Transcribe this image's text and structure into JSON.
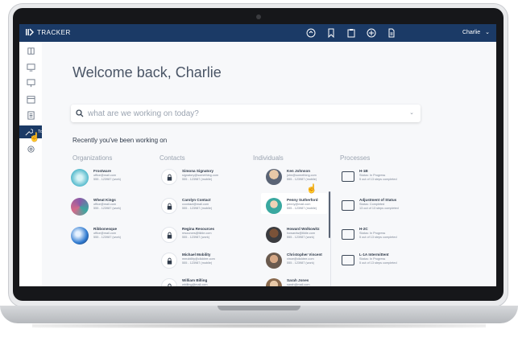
{
  "app": {
    "brand": "TRACKER",
    "user_name": "Charlie",
    "user_chevron": "⌄"
  },
  "topbar": {
    "icons": [
      "chat-icon",
      "bookmark-icon",
      "clipboard-icon",
      "add-circle-icon",
      "document-icon"
    ]
  },
  "sidebar": {
    "items": [
      {
        "icon": "book-icon",
        "label": ""
      },
      {
        "icon": "monitor-icon",
        "label": ""
      },
      {
        "icon": "presentation-icon",
        "label": ""
      },
      {
        "icon": "calendar-icon",
        "label": ""
      },
      {
        "icon": "list-icon",
        "label": ""
      },
      {
        "icon": "wrench-icon",
        "label": "Tools"
      },
      {
        "icon": "settings-icon",
        "label": ""
      }
    ]
  },
  "main": {
    "welcome": "Welcome back, Charlie",
    "search_placeholder": "what are we working on today?",
    "recent_title": "Recently you've been working on",
    "columns": {
      "organizations": "Organizations",
      "contacts": "Contacts",
      "individuals": "Individuals",
      "processes": "Processes"
    },
    "organizations": [
      {
        "name": "Frostware",
        "email": "office@mail.com",
        "phone": "555 - 123987 (work)"
      },
      {
        "name": "Wheat Kings",
        "email": "office@mail.com",
        "phone": "555 - 123987 (work)"
      },
      {
        "name": "Ribbonesque",
        "email": "office@mail.com",
        "phone": "555 - 123987 (work)"
      }
    ],
    "contacts": [
      {
        "name": "Simona Signatory",
        "email": "signatory@something.com",
        "phone": "555 - 123987 (mobile)"
      },
      {
        "name": "Carolyn Contact",
        "email": "ccontact@mail.com",
        "phone": "555 - 123987 (mobile)"
      },
      {
        "name": "Regina Resources",
        "email": "resources@tiktie.com",
        "phone": "555 - 123987 (work)"
      },
      {
        "name": "Michael Mobility",
        "email": "mmobility@clicktee.com",
        "phone": "555 - 123987 (mobile)"
      },
      {
        "name": "William Billing",
        "email": "wbilling@mail.com",
        "phone": ""
      }
    ],
    "individuals": [
      {
        "name": "Ken Johnson",
        "email": "john@something.com",
        "phone": "555 - 123987 (mobile)"
      },
      {
        "name": "Penny Sutherford",
        "email": "penny@mail.com",
        "phone": "555 - 123987 (mobile)"
      },
      {
        "name": "Howard Wolkowitz",
        "email": "howardw@tiktie.com",
        "phone": "555 - 123987 (work)"
      },
      {
        "name": "Christopher Vincent",
        "email": "vince@clicktee.com",
        "phone": "555 - 123987 (work)"
      },
      {
        "name": "Sarah Jones",
        "email": "sarah@mail.com",
        "phone": ""
      }
    ],
    "processes": [
      {
        "name": "H-1B",
        "status": "Status: In Progress",
        "steps": "5 out of 13 steps completed"
      },
      {
        "name": "Adjustment of Status",
        "status": "Status: Completed",
        "steps": "13 out of 13 steps completed"
      },
      {
        "name": "H-2C",
        "status": "Status: In Progress",
        "steps": "5 out of 13 steps completed"
      },
      {
        "name": "L-1A Intermittent",
        "status": "Status: In Progress",
        "steps": "5 out of 13 steps completed"
      }
    ]
  },
  "colors": {
    "topbar": "#1b3a66",
    "text_dark": "#2f3a4a",
    "text_muted": "#9aa3b0"
  }
}
